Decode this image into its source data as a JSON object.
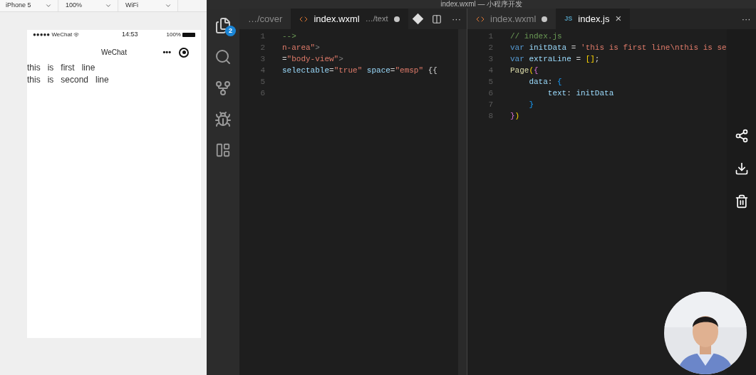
{
  "simulator": {
    "toolbar": [
      {
        "label": "iPhone 5"
      },
      {
        "label": "100%"
      },
      {
        "label": "WiFi"
      }
    ],
    "phone": {
      "carrier": "●●●●● WeChat",
      "time": "14:53",
      "battery": "100%",
      "nav_title": "WeChat",
      "menu_dots": "•••",
      "content_lines": [
        "this   is   first   line",
        "this   is   second   line"
      ]
    }
  },
  "window": {
    "title": "index.wxml — 小程序开发"
  },
  "activity_bar": {
    "badge": "2"
  },
  "editor_left": {
    "tabs": [
      {
        "label": "…/cover",
        "selected": false,
        "dirty": false,
        "kind": "plain"
      },
      {
        "label": "index.wxml",
        "path": "…/text",
        "selected": true,
        "dirty": true,
        "kind": "wxml"
      }
    ],
    "more": "···",
    "lines": [
      {
        "number": "1",
        "tokens": [
          {
            "text": "-->",
            "kind": "comment"
          }
        ]
      },
      {
        "number": "2",
        "tokens": [
          {
            "text": "n-area\"",
            "kind": "string"
          },
          {
            "text": ">",
            "kind": "punct"
          }
        ]
      },
      {
        "number": "3",
        "tokens": [
          {
            "text": "=",
            "kind": "plain"
          },
          {
            "text": "\"body-view\"",
            "kind": "string"
          },
          {
            "text": ">",
            "kind": "punct"
          }
        ]
      },
      {
        "number": "4",
        "tokens": [
          {
            "text": "selectable",
            "kind": "attr"
          },
          {
            "text": "=",
            "kind": "plain"
          },
          {
            "text": "\"true\"",
            "kind": "string"
          },
          {
            "text": " space",
            "kind": "attr"
          },
          {
            "text": "=",
            "kind": "plain"
          },
          {
            "text": "\"emsp\"",
            "kind": "string"
          },
          {
            "text": " {{",
            "kind": "plain"
          }
        ]
      },
      {
        "number": "5"
      },
      {
        "number": "6"
      }
    ]
  },
  "editor_right": {
    "tabs": [
      {
        "label": "index.wxml",
        "selected": false,
        "dirty": true,
        "kind": "wxml"
      },
      {
        "label": "index.js",
        "icon_text": "JS",
        "close": "×",
        "selected": true,
        "dirty": false,
        "kind": "js"
      }
    ],
    "more": "···",
    "lines": [
      {
        "number": "1",
        "tokens": [
          {
            "text": "// index.js",
            "kind": "comment"
          }
        ]
      },
      {
        "number": "2",
        "tokens": [
          {
            "text": "var",
            "kind": "keyword"
          },
          {
            "text": " initData",
            "kind": "variable"
          },
          {
            "text": " = ",
            "kind": "plain"
          },
          {
            "text": "'this is first line\\nthis is se",
            "kind": "string"
          }
        ]
      },
      {
        "number": "3",
        "tokens": [
          {
            "text": "var",
            "kind": "keyword"
          },
          {
            "text": " extraLine",
            "kind": "variable"
          },
          {
            "text": " = ",
            "kind": "plain"
          },
          {
            "text": "[]",
            "kind": "bracket1"
          },
          {
            "text": ";",
            "kind": "plain"
          }
        ]
      },
      {
        "number": "4",
        "tokens": [
          {
            "text": "Page",
            "kind": "function"
          },
          {
            "text": "(",
            "kind": "bracket1"
          },
          {
            "text": "{",
            "kind": "bracket2"
          }
        ]
      },
      {
        "number": "5",
        "tokens": [
          {
            "text": "    data",
            "kind": "variable"
          },
          {
            "text": ": ",
            "kind": "plain"
          },
          {
            "text": "{",
            "kind": "bracket3"
          }
        ]
      },
      {
        "number": "6",
        "tokens": [
          {
            "text": "        text",
            "kind": "variable"
          },
          {
            "text": ": ",
            "kind": "plain"
          },
          {
            "text": "initData",
            "kind": "variable"
          }
        ]
      },
      {
        "number": "7",
        "tokens": [
          {
            "text": "    }",
            "kind": "bracket3"
          }
        ]
      },
      {
        "number": "8",
        "tokens": [
          {
            "text": "}",
            "kind": "bracket2"
          },
          {
            "text": ")",
            "kind": "bracket1"
          }
        ]
      }
    ]
  }
}
